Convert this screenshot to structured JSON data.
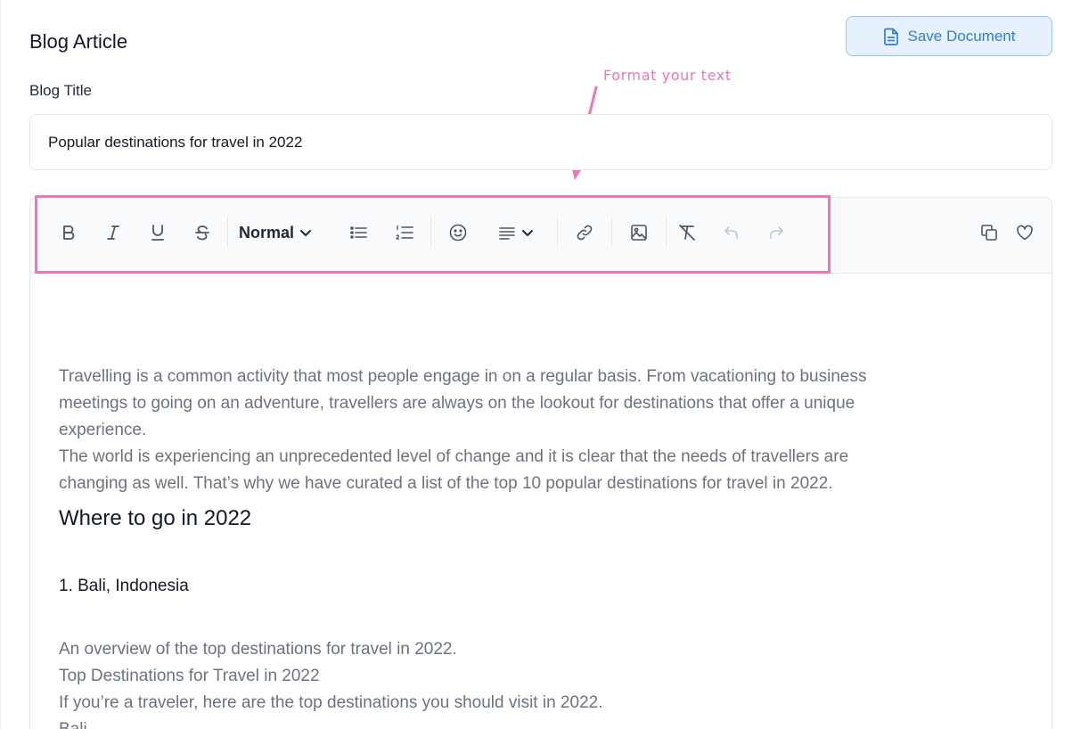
{
  "page": {
    "title": "Blog Article",
    "save_button_label": "Save Document"
  },
  "annotation": {
    "text": "Format your text",
    "color": "#f472b6"
  },
  "form": {
    "title_label": "Blog Title",
    "title_value": "Popular destinations for travel in 2022"
  },
  "toolbar": {
    "heading_select": "Normal",
    "icons": [
      "bold-icon",
      "italic-icon",
      "underline-icon",
      "strikethrough-icon",
      "bullet-list-icon",
      "ordered-list-icon",
      "emoji-icon",
      "align-icon",
      "link-icon",
      "image-icon",
      "clear-format-icon",
      "undo-icon",
      "redo-icon",
      "copy-icon",
      "heart-icon"
    ]
  },
  "editor": {
    "para1_line1": "Travelling is a common activity that most people engage in on a regular basis. From vacationing to business",
    "para1_line2": "meetings to going on an adventure, travellers are always on the lookout for destinations that offer a unique",
    "para1_line3": "experience.",
    "para2_line1": "The world is experiencing an unprecedented level of change and it is clear that the needs of travellers are",
    "para2_line2": "changing as well. That’s why we have curated a list of the top 10 popular destinations for travel in 2022.",
    "heading": "Where to go in 2022",
    "subheading": "1. Bali, Indonesia",
    "line_a": "An overview of the top destinations for travel in 2022.",
    "line_b": "Top Destinations for Travel in 2022",
    "line_c": "If you’re a traveler, here are the top destinations you should visit in 2022.",
    "line_d": "Bali"
  },
  "colors": {
    "accent": "#2f7fd8",
    "highlight": "#f472b6"
  }
}
